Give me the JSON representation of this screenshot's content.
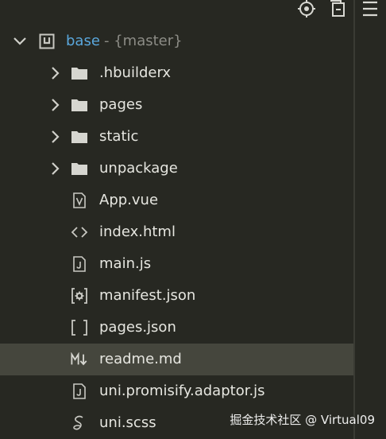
{
  "toolbar": {
    "locate_icon": "crosshair-icon",
    "collapse_icon": "collapse-all-icon",
    "menu_icon": "hamburger-menu-icon"
  },
  "tree": {
    "root": {
      "label": "base",
      "branch": "- {master}",
      "expanded": true,
      "icon": "project-icon"
    },
    "items": [
      {
        "label": ".hbuilderx",
        "type": "folder",
        "expandable": true,
        "icon": "folder-icon"
      },
      {
        "label": "pages",
        "type": "folder",
        "expandable": true,
        "icon": "folder-icon"
      },
      {
        "label": "static",
        "type": "folder",
        "expandable": true,
        "icon": "folder-icon"
      },
      {
        "label": "unpackage",
        "type": "folder",
        "expandable": true,
        "icon": "folder-icon"
      },
      {
        "label": "App.vue",
        "type": "file",
        "icon": "vue-file-icon"
      },
      {
        "label": "index.html",
        "type": "file",
        "icon": "html-file-icon"
      },
      {
        "label": "main.js",
        "type": "file",
        "icon": "js-file-icon"
      },
      {
        "label": "manifest.json",
        "type": "file",
        "icon": "manifest-json-icon"
      },
      {
        "label": "pages.json",
        "type": "file",
        "icon": "json-file-icon"
      },
      {
        "label": "readme.md",
        "type": "file",
        "icon": "markdown-file-icon",
        "selected": true
      },
      {
        "label": "uni.promisify.adaptor.js",
        "type": "file",
        "icon": "js-file-icon"
      },
      {
        "label": "uni.scss",
        "type": "file",
        "icon": "scss-file-icon"
      }
    ]
  },
  "watermark": "掘金技术社区 @ Virtual09",
  "colors": {
    "background": "#272822",
    "selected_row": "#45463d",
    "root_label": "#5aa7dc",
    "text": "#e6e6e0"
  }
}
